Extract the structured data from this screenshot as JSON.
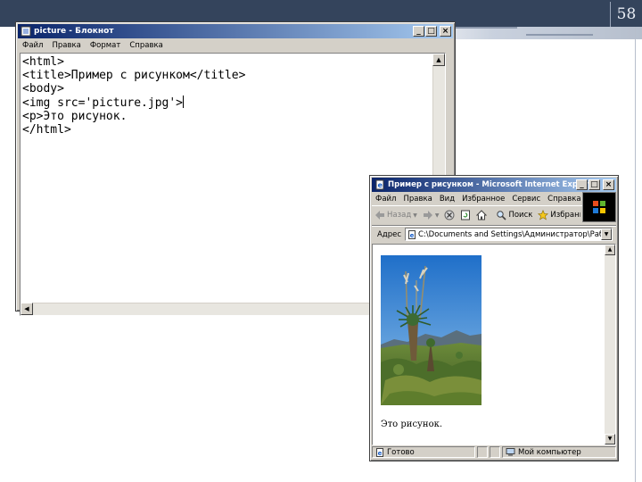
{
  "slide": {
    "page_number": "58",
    "accent_color": "#34445c"
  },
  "notepad": {
    "title": "picture - Блокнот",
    "window_buttons": {
      "minimize": "_",
      "maximize": "□",
      "close": "×"
    },
    "menu": [
      "Файл",
      "Правка",
      "Формат",
      "Справка"
    ],
    "code_lines": [
      "<html>",
      "<title>Пример с рисунком</title>",
      "<body>",
      "<img src='picture.jpg'>",
      "<p>Это рисунок.",
      "</html>"
    ]
  },
  "ie": {
    "title": "Пример с рисунком - Microsoft Internet Explorer",
    "window_buttons": {
      "minimize": "_",
      "maximize": "□",
      "close": "×"
    },
    "menu": [
      "Файл",
      "Правка",
      "Вид",
      "Избранное",
      "Сервис",
      "Справка"
    ],
    "toolbar": {
      "back": "Назад",
      "search": "Поиск",
      "favorites": "Избранное"
    },
    "address_label": "Адрес",
    "address_value": "C:\\Documents and Settings\\Администратор\\Рабочий ст",
    "page_text": "Это рисунок.",
    "status_left": "Готово",
    "status_right": "Мой компьютер"
  }
}
